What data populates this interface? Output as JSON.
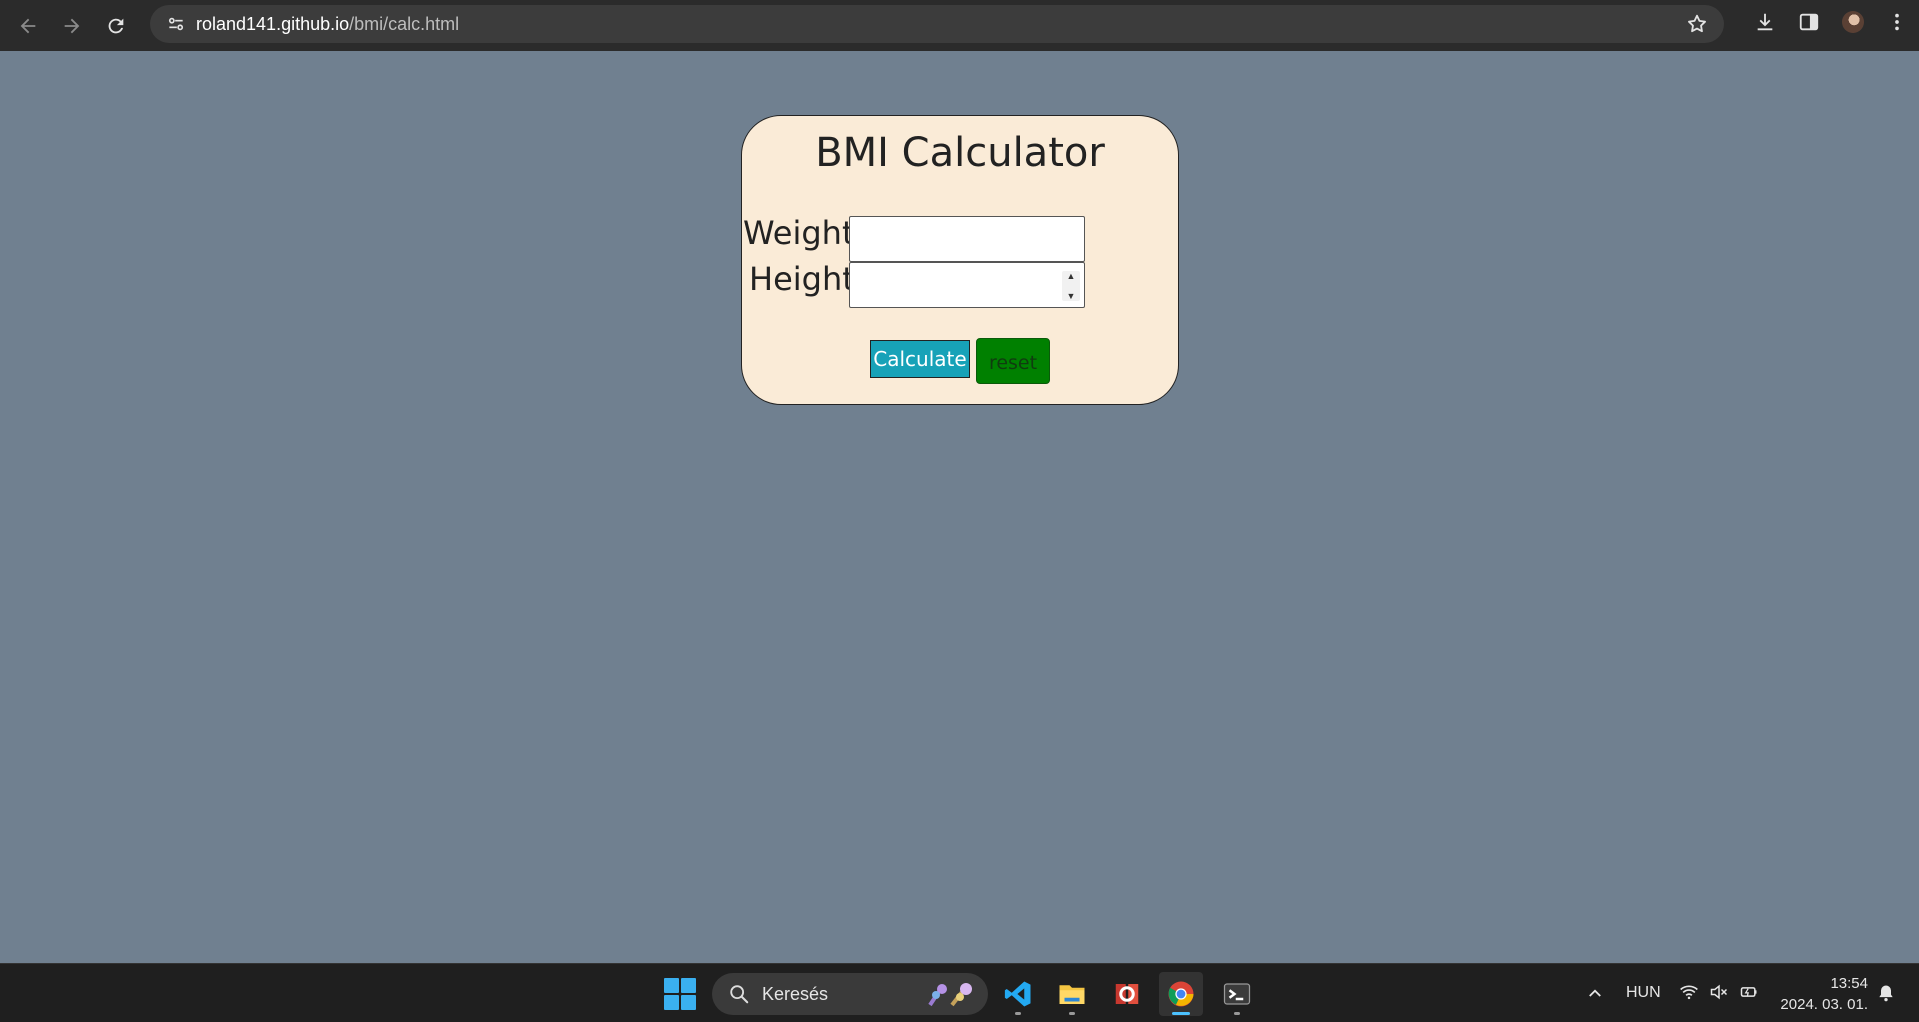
{
  "browser": {
    "url_host": "roland141.github.io",
    "url_path": "/bmi/calc.html"
  },
  "card": {
    "title": "BMI Calculator",
    "weight_label": "Weight:",
    "height_label": "Height:",
    "weight_value": "",
    "height_value": "",
    "calculate_label": "Calculate",
    "reset_label": "reset",
    "colors": {
      "background": "#faebd7",
      "calculate": "#17a2b8",
      "reset": "#008000",
      "page": "#708090"
    }
  },
  "taskbar": {
    "search_placeholder": "Keresés",
    "language": "HUN",
    "time": "13:54",
    "date": "2024. 03. 01.",
    "apps": [
      "vscode-icon",
      "file-explorer-icon",
      "office-icon",
      "chrome-icon",
      "terminal-icon"
    ]
  }
}
